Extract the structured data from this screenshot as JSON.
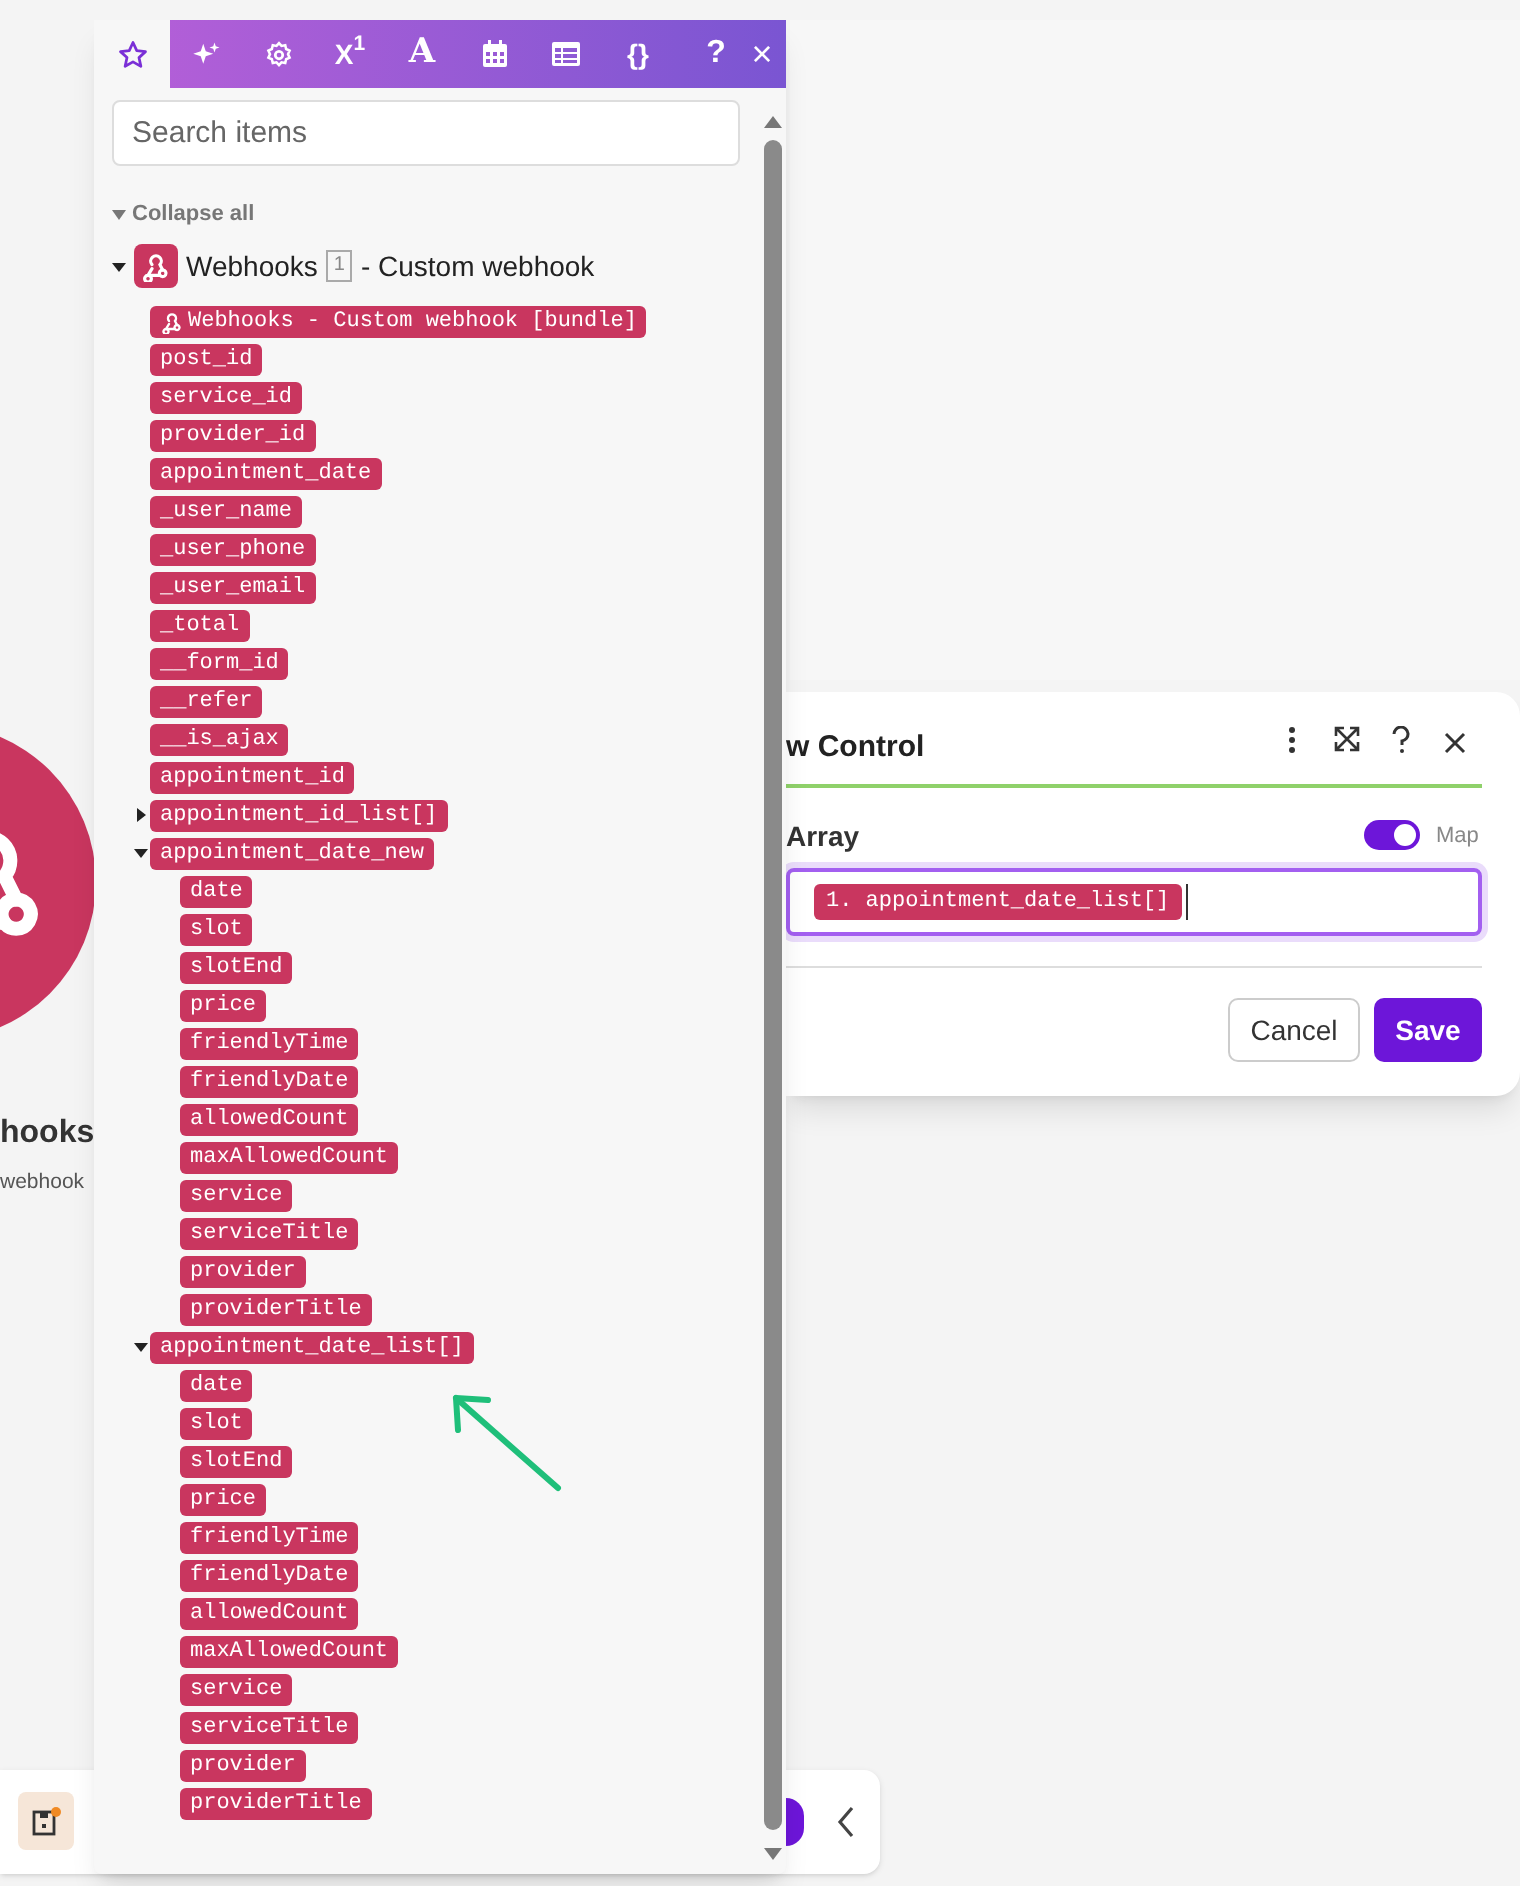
{
  "canvas": {
    "module_title": "hooks",
    "module_subtitle": "webhook"
  },
  "panel": {
    "tabs": [
      {
        "kind": "star",
        "selected": true
      },
      {
        "kind": "sparkle",
        "selected": false
      },
      {
        "kind": "gear",
        "selected": false
      },
      {
        "kind": "math",
        "label": "X$^{1}$",
        "selected": false
      },
      {
        "kind": "text",
        "label": "A",
        "selected": false
      },
      {
        "kind": "calendar",
        "selected": false
      },
      {
        "kind": "table",
        "selected": false
      },
      {
        "kind": "braces",
        "label": "{}",
        "selected": false
      }
    ],
    "help": "?",
    "close": "×",
    "search": {
      "placeholder": "Search items"
    },
    "collapse_all": "Collapse all",
    "tree": {
      "app": "Webhooks",
      "badge": "1",
      "title": "- Custom webhook",
      "expanded": true,
      "children": [
        {
          "label": "Webhooks - Custom webhook [bundle]",
          "kind": "bundle"
        },
        {
          "label": "post_id"
        },
        {
          "label": "service_id"
        },
        {
          "label": "provider_id"
        },
        {
          "label": "appointment_date"
        },
        {
          "label": "_user_name"
        },
        {
          "label": "_user_phone"
        },
        {
          "label": "_user_email"
        },
        {
          "label": "_total"
        },
        {
          "label": "__form_id"
        },
        {
          "label": "__refer"
        },
        {
          "label": "__is_ajax"
        },
        {
          "label": "appointment_id"
        },
        {
          "label": "appointment_id_list[]",
          "expanded": false
        },
        {
          "label": "appointment_date_new",
          "expanded": true,
          "children": [
            {
              "label": "date"
            },
            {
              "label": "slot"
            },
            {
              "label": "slotEnd"
            },
            {
              "label": "price"
            },
            {
              "label": "friendlyTime"
            },
            {
              "label": "friendlyDate"
            },
            {
              "label": "allowedCount"
            },
            {
              "label": "maxAllowedCount"
            },
            {
              "label": "service"
            },
            {
              "label": "serviceTitle"
            },
            {
              "label": "provider"
            },
            {
              "label": "providerTitle"
            }
          ]
        },
        {
          "label": "appointment_date_list[]",
          "expanded": true,
          "children": [
            {
              "label": "date"
            },
            {
              "label": "slot"
            },
            {
              "label": "slotEnd"
            },
            {
              "label": "price"
            },
            {
              "label": "friendlyTime"
            },
            {
              "label": "friendlyDate"
            },
            {
              "label": "allowedCount"
            },
            {
              "label": "maxAllowedCount"
            },
            {
              "label": "service"
            },
            {
              "label": "serviceTitle"
            },
            {
              "label": "provider"
            },
            {
              "label": "providerTitle"
            }
          ]
        }
      ]
    }
  },
  "dialog": {
    "title": "w Control",
    "field_label": "Array",
    "map_toggle": {
      "on": true,
      "label": "Map"
    },
    "value_pill": "1. appointment_date_list[]",
    "buttons": [
      {
        "label": "Cancel",
        "kind": "secondary"
      },
      {
        "label": "Save",
        "kind": "primary"
      }
    ]
  }
}
